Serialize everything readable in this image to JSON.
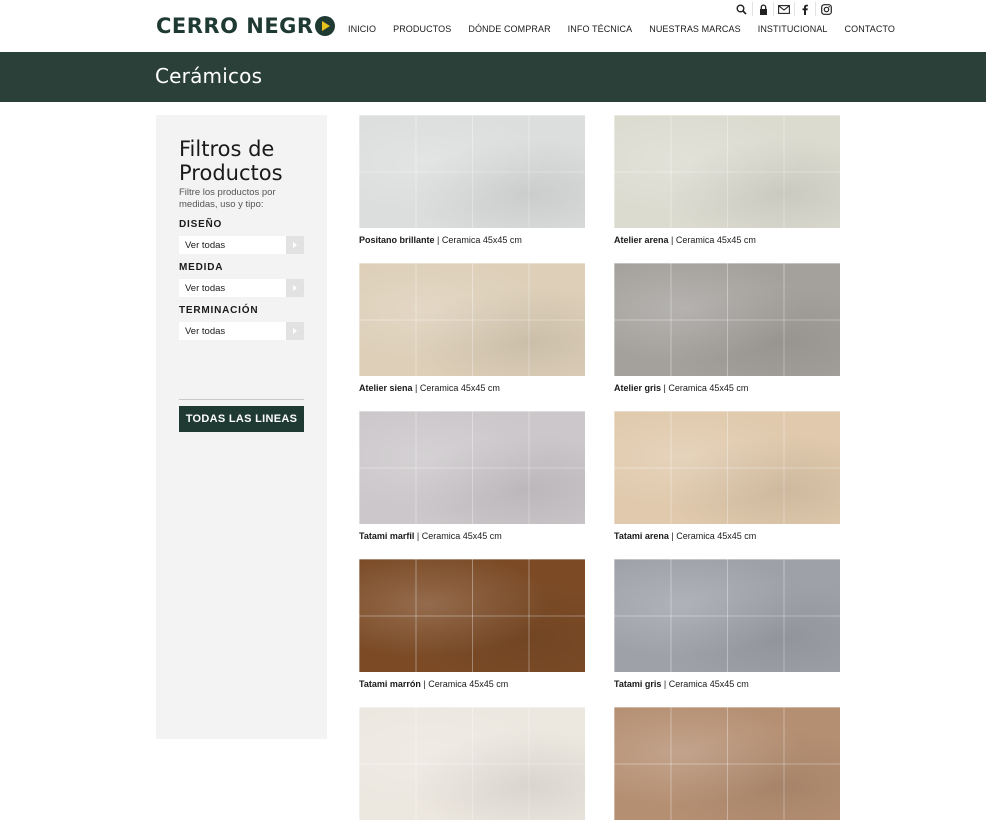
{
  "header": {
    "logo_text_1": "CERRO NEGR",
    "nav": [
      "INICIO",
      "PRODUCTOS",
      "DÓNDE COMPRAR",
      "INFO TÉCNICA",
      "NUESTRAS MARCAS",
      "INSTITUCIONAL",
      "CONTACTO"
    ],
    "icons": [
      "search-icon",
      "lock-icon",
      "mail-icon",
      "facebook-icon",
      "instagram-icon"
    ]
  },
  "banner": {
    "title": "Cerámicos"
  },
  "sidebar": {
    "title": "Filtros de Productos",
    "description": "Filtre los productos por medidas, uso y tipo:",
    "filters": [
      {
        "label": "DISEÑO",
        "value": "Ver todas"
      },
      {
        "label": "MEDIDA",
        "value": "Ver todas"
      },
      {
        "label": "TERMINACIÓN",
        "value": "Ver todas"
      }
    ],
    "button": "TODAS LAS LINEAS"
  },
  "products": [
    {
      "name": "Positano brillante",
      "detail": " | Ceramica 45x45 cm",
      "color": "#dcdedd"
    },
    {
      "name": "Atelier arena",
      "detail": " | Ceramica 45x45 cm",
      "color": "#dcdbd0"
    },
    {
      "name": "Atelier siena",
      "detail": " | Ceramica 45x45 cm",
      "color": "#ddcfb8"
    },
    {
      "name": "Atelier gris",
      "detail": " | Ceramica 45x45 cm",
      "color": "#a4a19d"
    },
    {
      "name": "Tatami marfil",
      "detail": " | Ceramica 45x45 cm",
      "color": "#cbc7ca"
    },
    {
      "name": "Tatami arena",
      "detail": " | Ceramica 45x45 cm",
      "color": "#e0c9ac"
    },
    {
      "name": "Tatami marrón",
      "detail": " | Ceramica 45x45 cm",
      "color": "#7c4b26"
    },
    {
      "name": "Tatami gris",
      "detail": " | Ceramica 45x45 cm",
      "color": "#9ea1a8"
    },
    {
      "name": "",
      "detail": "",
      "color": "#ece7df"
    },
    {
      "name": "",
      "detail": "",
      "color": "#b58f72"
    }
  ],
  "colors": {
    "brand": "#1f3a33",
    "banner": "#2a4038",
    "accent": "#e8c21c"
  }
}
